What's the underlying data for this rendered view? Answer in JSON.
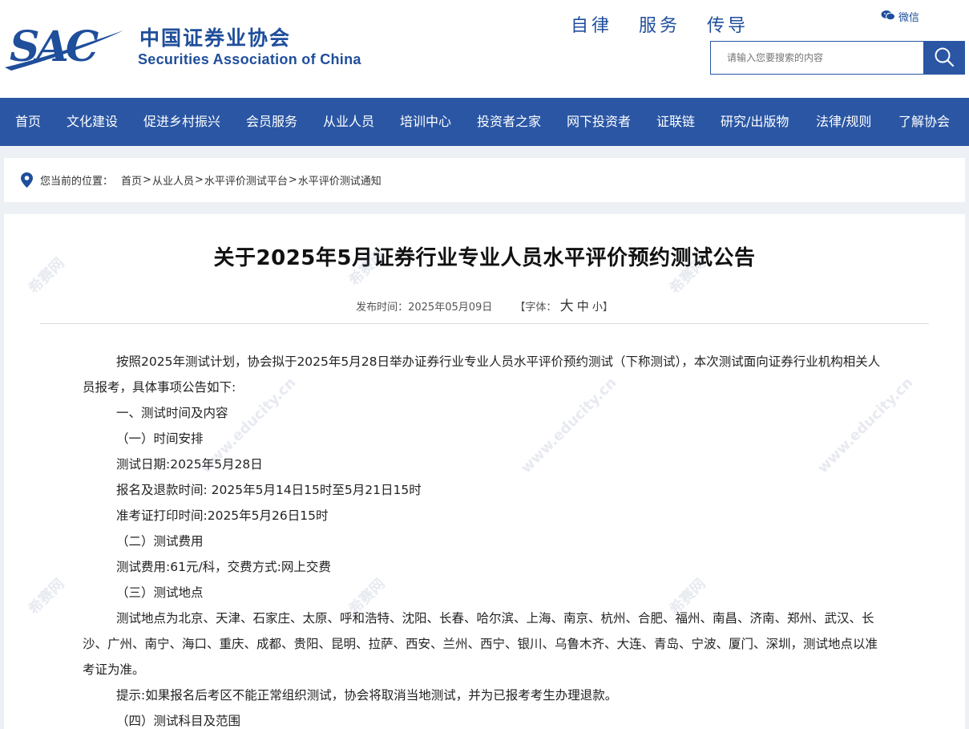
{
  "header": {
    "logo_mark": "SAC",
    "logo_cn": "中国证券业协会",
    "logo_en": "Securities Association of China",
    "slogan": [
      "自律",
      "服务",
      "传导"
    ],
    "wechat_label": "微信",
    "search_placeholder": "请输入您要搜索的内容"
  },
  "nav": [
    "首页",
    "文化建设",
    "促进乡村振兴",
    "会员服务",
    "从业人员",
    "培训中心",
    "投资者之家",
    "网下投资者",
    "证联链",
    "研究/出版物",
    "法律/规则",
    "了解协会"
  ],
  "breadcrumb": {
    "prefix": "您当前的位置：",
    "items": [
      "首页",
      "从业人员",
      "水平评价测试平台",
      "水平评价测试通知"
    ],
    "separator": ">"
  },
  "article": {
    "title": "关于2025年5月证券行业专业人员水平评价预约测试公告",
    "publish_label": "发布时间：",
    "publish_date": "2025年05月09日",
    "font_label_open": "【字体：",
    "font_large": "大",
    "font_medium": "中",
    "font_small": "小",
    "font_label_close": "】",
    "paragraphs": [
      "按照2025年测试计划，协会拟于2025年5月28日举办证券行业专业人员水平评价预约测试（下称测试），本次测试面向证券行业机构相关人员报考，具体事项公告如下:",
      "一、测试时间及内容",
      "（一）时间安排",
      "测试日期:2025年5月28日",
      "报名及退款时间: 2025年5月14日15时至5月21日15时",
      "准考证打印时间:2025年5月26日15时",
      "（二）测试费用",
      "测试费用:61元/科，交费方式:网上交费",
      "（三）测试地点",
      "测试地点为北京、天津、石家庄、太原、呼和浩特、沈阳、长春、哈尔滨、上海、南京、杭州、合肥、福州、南昌、济南、郑州、武汉、长沙、广州、南宁、海口、重庆、成都、贵阳、昆明、拉萨、西安、兰州、西宁、银川、乌鲁木齐、大连、青岛、宁波、厦门、深圳，测试地点以准考证为准。",
      "提示:如果报名后考区不能正常组织测试，协会将取消当地测试，并为已报考考生办理退款。",
      "（四）测试科目及范围"
    ]
  },
  "watermark": [
    "希赛网",
    "www.educity.cn"
  ],
  "colors": {
    "brand": "#2a56a4",
    "logo": "#1f4e9b"
  }
}
